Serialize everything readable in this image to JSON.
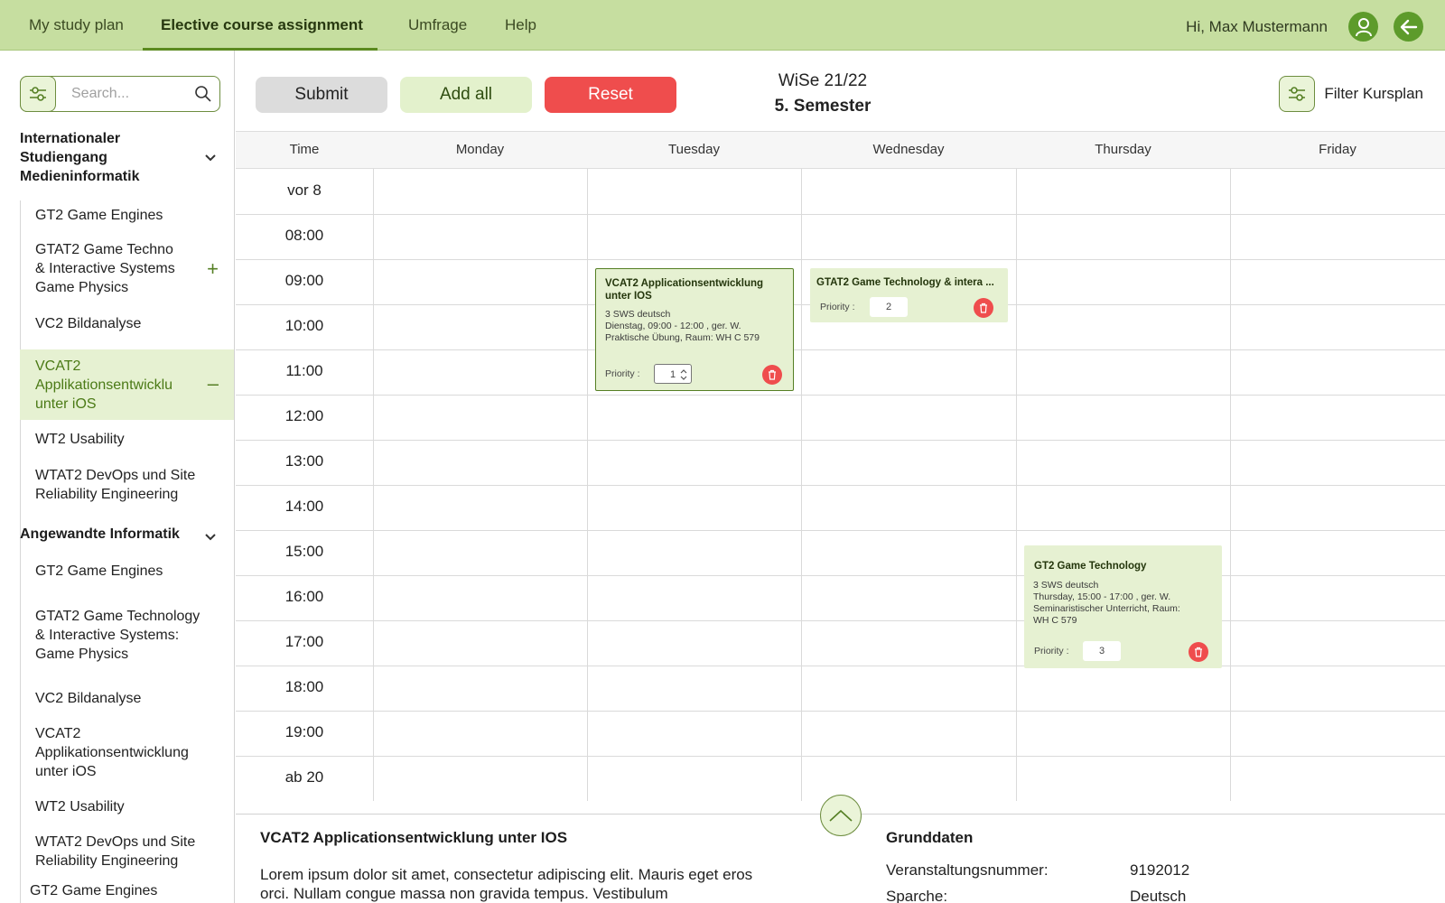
{
  "nav": {
    "tabs": [
      "My study plan",
      "Elective course assignment",
      "Umfrage",
      "Help"
    ],
    "active_tab": "Elective course assignment",
    "greeting": "Hi, Max Mustermann",
    "avatar_icon": "user-icon",
    "back_icon": "arrow-left-icon"
  },
  "sidebar": {
    "search_placeholder": "Search...",
    "groups": [
      {
        "title_lines": [
          "Internationaler",
          "Studiengang",
          "Medieninformatik"
        ],
        "items": [
          {
            "lines": [
              "GT2 Game Engines"
            ],
            "action": ""
          },
          {
            "lines": [
              "GTAT2 Game Techno",
              "& Interactive Systems",
              "Game Physics"
            ],
            "action": "+"
          },
          {
            "lines": [
              "VC2 Bildanalyse"
            ],
            "action": ""
          },
          {
            "lines": [
              "VCAT2",
              "Applikationsentwicklu",
              "unter iOS"
            ],
            "action": "–",
            "selected": true
          },
          {
            "lines": [
              "WT2 Usability"
            ],
            "action": ""
          },
          {
            "lines": [
              "WTAT2 DevOps und Site",
              "Reliability Engineering"
            ],
            "action": ""
          }
        ]
      },
      {
        "title_lines": [
          "Angewandte Informatik"
        ],
        "items": [
          {
            "lines": [
              "GT2 Game Engines"
            ],
            "action": ""
          },
          {
            "lines": [
              "GTAT2 Game Technology",
              "& Interactive Systems:",
              "Game Physics"
            ],
            "action": ""
          },
          {
            "lines": [
              "VC2 Bildanalyse"
            ],
            "action": ""
          },
          {
            "lines": [
              "VCAT2",
              "Applikationsentwicklung",
              "unter iOS"
            ],
            "action": ""
          },
          {
            "lines": [
              "WT2 Usability"
            ],
            "action": ""
          },
          {
            "lines": [
              "WTAT2 DevOps und Site",
              "Reliability Engineering"
            ],
            "action": ""
          }
        ]
      }
    ],
    "trailing_item": "GT2 Game Engines"
  },
  "toolbar": {
    "submit": "Submit",
    "add_all": "Add all",
    "reset": "Reset",
    "term": "WiSe 21/22",
    "semester": "5. Semester",
    "filter_label": "Filter Kursplan"
  },
  "schedule": {
    "time_header": "Time",
    "days": [
      "Monday",
      "Tuesday",
      "Wednesday",
      "Thursday",
      "Friday"
    ],
    "slots": [
      "vor 8",
      "08:00",
      "09:00",
      "10:00",
      "11:00",
      "12:00",
      "13:00",
      "14:00",
      "15:00",
      "16:00",
      "17:00",
      "18:00",
      "19:00",
      "ab 20"
    ],
    "courses": [
      {
        "day": "Tuesday",
        "title_lines": [
          "VCAT2 Applicationsentwicklung",
          "unter IOS"
        ],
        "details": [
          "3 SWS   deutsch",
          "Dienstag,  09:00 - 12:00 , ger. W.",
          "Praktische Übung, Raum: WH C 579"
        ],
        "priority_label": "Priority :",
        "priority": "1",
        "selected": true
      },
      {
        "day": "Wednesday",
        "title_lines": [
          "GTAT2 Game Technology & intera ..."
        ],
        "details": [],
        "priority_label": "Priority :",
        "priority": "2",
        "selected": false
      },
      {
        "day": "Thursday",
        "title_lines": [
          "GT2 Game Technology"
        ],
        "details": [
          "3 SWS   deutsch",
          "Thursday,  15:00 - 17:00 , ger. W.",
          "Seminaristischer Unterricht, Raum:",
          "WH C 579"
        ],
        "priority_label": "Priority :",
        "priority": "3",
        "selected": false
      }
    ]
  },
  "detail": {
    "title": "VCAT2 Applicationsentwicklung unter IOS",
    "text": "Lorem ipsum dolor sit amet, consectetur adipiscing elit. Mauris eget eros orci. Nullam congue massa non gravida tempus. Vestibulum",
    "basics_title": "Grunddaten",
    "fields": [
      {
        "label": "Veranstaltungsnummer:",
        "value": "9192012"
      },
      {
        "label": "Sparche:",
        "value": "Deutsch"
      }
    ]
  }
}
